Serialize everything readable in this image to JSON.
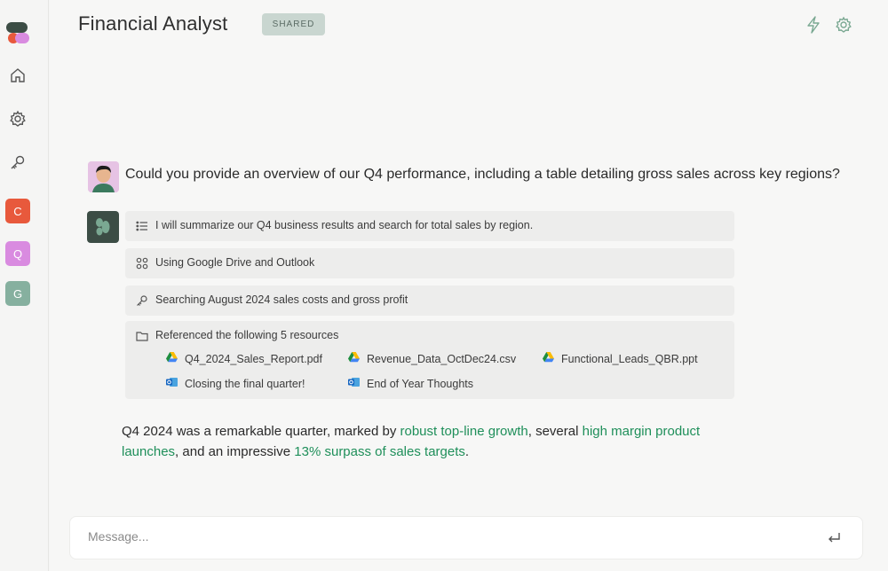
{
  "header": {
    "title": "Financial Analyst",
    "badge": "SHARED",
    "icons": [
      "bolt-icon",
      "settings-icon"
    ]
  },
  "sidebar": {
    "nav": [
      "home-icon",
      "gear-icon",
      "key-icon"
    ],
    "workspaces": [
      {
        "letter": "C",
        "color": "#e8593c"
      },
      {
        "letter": "Q",
        "color": "#d98be0"
      },
      {
        "letter": "G",
        "color": "#86b09f"
      }
    ]
  },
  "chat": {
    "question": "Could you provide an overview of our Q4 performance, including a table detailing gross sales across key regions?",
    "steps": [
      {
        "icon": "list-icon",
        "text": "I will summarize our Q4 business results and search for total sales by region."
      },
      {
        "icon": "apps-icon",
        "text": "Using Google Drive and Outlook"
      },
      {
        "icon": "key-icon",
        "text": "Searching August 2024 sales costs and gross profit"
      },
      {
        "icon": "folder-icon",
        "text": "Referenced the following 5 resources"
      }
    ],
    "resources": [
      {
        "type": "google-drive",
        "name": "Q4_2024_Sales_Report.pdf"
      },
      {
        "type": "google-drive",
        "name": "Revenue_Data_OctDec24.csv"
      },
      {
        "type": "google-drive",
        "name": "Functional_Leads_QBR.ppt"
      },
      {
        "type": "outlook",
        "name": "Closing the final quarter!"
      },
      {
        "type": "outlook",
        "name": "End of Year Thoughts"
      }
    ],
    "answer": {
      "p1": "Q4 2024 was a remarkable quarter, marked by ",
      "h1": "robust top-line growth",
      "p2": ", several ",
      "h2": "high margin product launches",
      "p3": ", and an impressive ",
      "h3": "13% surpass of sales targets",
      "p4": "."
    }
  },
  "composer": {
    "placeholder": "Message..."
  },
  "colors": {
    "accent_green": "#1f8f5a",
    "badge_bg": "#c9d6d0",
    "bot_avatar": "#3c4d45"
  }
}
